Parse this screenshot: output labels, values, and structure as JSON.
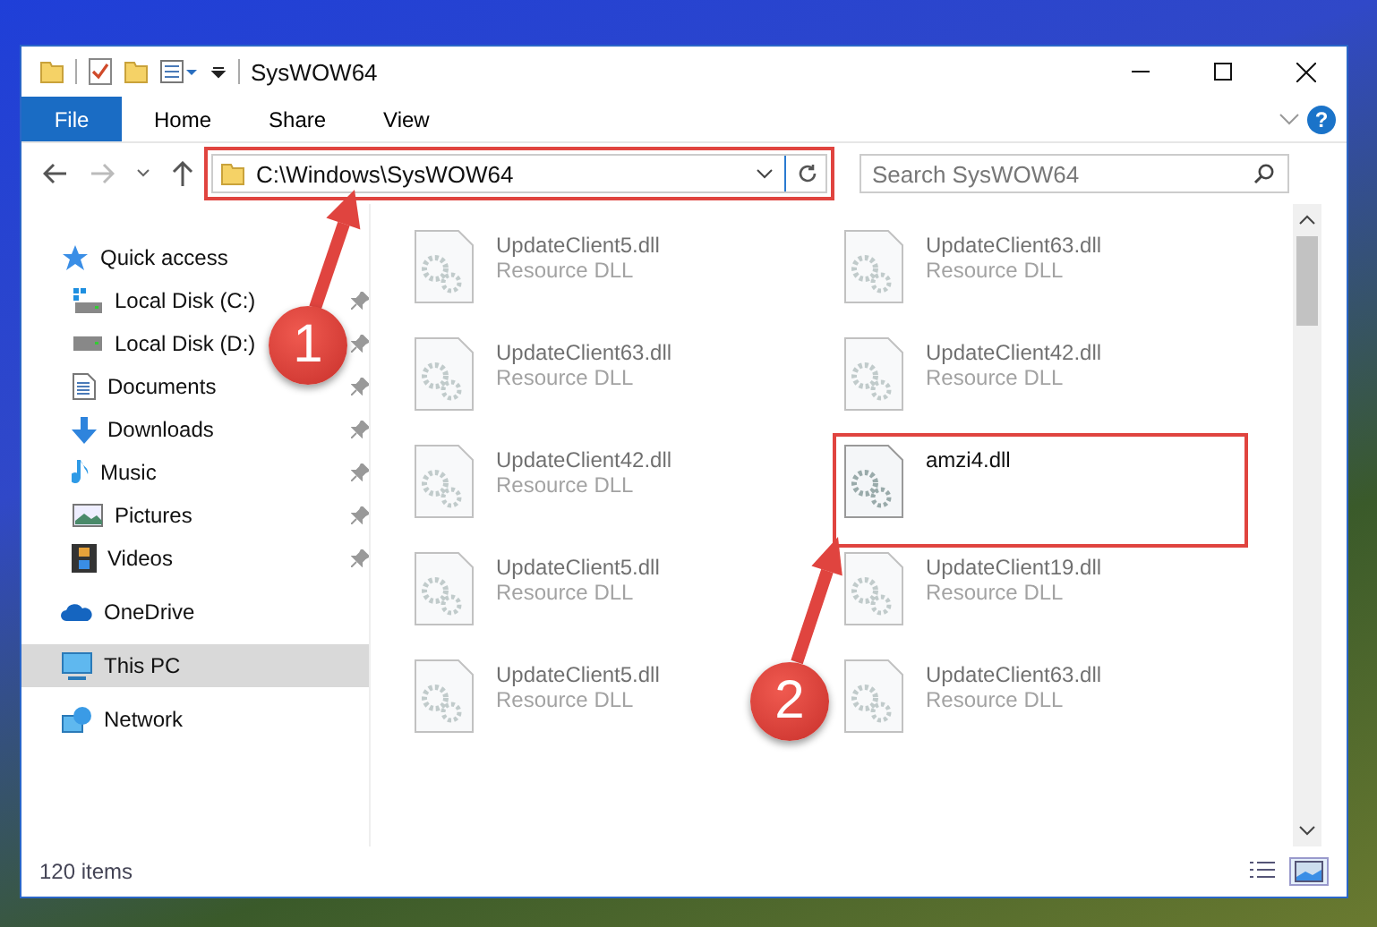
{
  "window": {
    "title": "SysWOW64"
  },
  "help": {
    "label": "?"
  },
  "ribbon_tabs": [
    {
      "label": "File",
      "kind": "file"
    },
    {
      "label": "Home",
      "kind": "tab"
    },
    {
      "label": "Share",
      "kind": "tab"
    },
    {
      "label": "View",
      "kind": "tab"
    }
  ],
  "address_bar": {
    "path": "C:\\Windows\\SysWOW64",
    "highlighted": true
  },
  "search": {
    "placeholder": "Search SysWOW64"
  },
  "sidebar": {
    "items": [
      {
        "label": "Quick access",
        "selected": false,
        "children": [
          {
            "label": "Local Disk (C:)",
            "pinned": true,
            "selected": false
          },
          {
            "label": "Local Disk (D:)",
            "pinned": true,
            "selected": false
          },
          {
            "label": "Documents",
            "pinned": true,
            "selected": false
          },
          {
            "label": "Downloads",
            "pinned": true,
            "selected": false
          },
          {
            "label": "Music",
            "pinned": true,
            "selected": false
          },
          {
            "label": "Pictures",
            "pinned": true,
            "selected": false
          },
          {
            "label": "Videos",
            "pinned": true,
            "selected": false
          }
        ]
      },
      {
        "label": "OneDrive",
        "selected": false
      },
      {
        "label": "This PC",
        "selected": true
      },
      {
        "label": "Network",
        "selected": false
      }
    ]
  },
  "files": [
    {
      "name": "UpdateClient5.dll",
      "type": "Resource DLL",
      "blurred": true,
      "highlighted": false
    },
    {
      "name": "UpdateClient63.dll",
      "type": "Resource DLL",
      "blurred": true,
      "highlighted": false
    },
    {
      "name": "UpdateClient63.dll",
      "type": "Resource DLL",
      "blurred": true,
      "highlighted": false
    },
    {
      "name": "UpdateClient42.dll",
      "type": "Resource DLL",
      "blurred": true,
      "highlighted": false
    },
    {
      "name": "UpdateClient42.dll",
      "type": "Resource DLL",
      "blurred": true,
      "highlighted": false
    },
    {
      "name": "amzi4.dll",
      "blurred": false,
      "highlighted": true
    },
    {
      "name": "UpdateClient5.dll",
      "type": "Resource DLL",
      "blurred": true,
      "highlighted": false
    },
    {
      "name": "UpdateClient19.dll",
      "type": "Resource DLL",
      "blurred": true,
      "highlighted": false
    },
    {
      "name": "UpdateClient5.dll",
      "type": "Resource DLL",
      "blurred": true,
      "highlighted": false
    },
    {
      "name": "UpdateClient63.dll",
      "type": "Resource DLL",
      "blurred": true,
      "highlighted": false
    }
  ],
  "status_bar": {
    "count": "120 items",
    "view_buttons": [
      {
        "kind": "details",
        "selected": false
      },
      {
        "kind": "tiles",
        "selected": true
      }
    ]
  },
  "annotations": [
    {
      "number": "1"
    },
    {
      "number": "2"
    }
  ]
}
